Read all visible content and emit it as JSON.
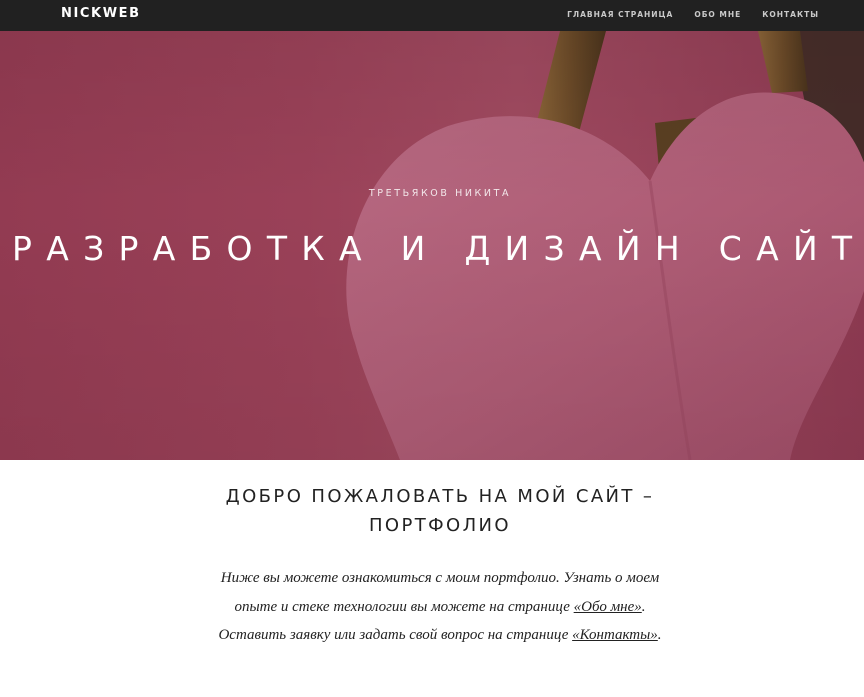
{
  "navbar": {
    "brand": "NICKWEB",
    "links": [
      "ГЛАВНАЯ СТРАНИЦА",
      "ОБО МНЕ",
      "КОНТАКТЫ"
    ]
  },
  "hero": {
    "subtitle": "ТРЕТЬЯКОВ НИКИТА",
    "title": "РАЗРАБОТКА И ДИЗАЙН САЙТОВ",
    "background_color": "#9a4158",
    "heart_color": "#b2627a",
    "easel_color": "#6f4e2c"
  },
  "content": {
    "heading_line1": "ДОБРО ПОЖАЛОВАТЬ НА МОЙ САЙТ –",
    "heading_line2": "ПОРТФОЛИО",
    "intro": {
      "line1": "Ниже вы можете ознакомиться с моим портфолио. Узнать о моем",
      "line2_text": "опыте и стеке технологии вы можете на странице ",
      "line2_link": "«Обо мне»",
      "line2_end": ".",
      "line3_text": "Оставить заявку или задать свой вопрос на странице ",
      "line3_link": "«Контакты»",
      "line3_end": "."
    }
  }
}
